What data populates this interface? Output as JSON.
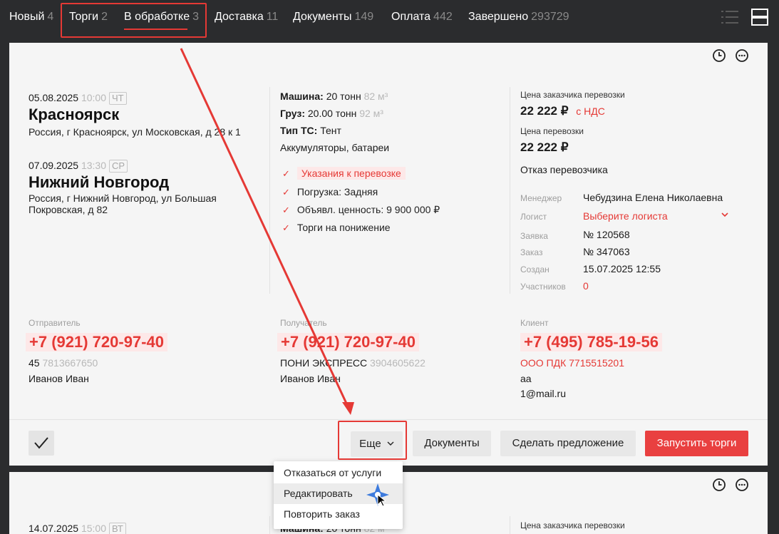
{
  "tabs": [
    {
      "label": "Новый",
      "count": "4"
    },
    {
      "label": "Торги",
      "count": "2"
    },
    {
      "label": "В обработке",
      "count": "3"
    },
    {
      "label": "Доставка",
      "count": "11"
    },
    {
      "label": "Документы",
      "count": "149"
    },
    {
      "label": "Оплата",
      "count": "442"
    },
    {
      "label": "Завершено",
      "count": "293729"
    }
  ],
  "order": {
    "load": {
      "date": "05.08.2025",
      "time": "10:00",
      "day": "ЧТ",
      "city": "Красноярск",
      "address": "Россия, г Красноярск, ул Московская, д 28 к 1"
    },
    "unload": {
      "date": "07.09.2025",
      "time": "13:30",
      "day": "СР",
      "city": "Нижний Новгород",
      "address": "Россия, г Нижний Новгород, ул Большая Покровская, д 82"
    },
    "vehicle": {
      "label": "Машина:",
      "value": "20 тонн",
      "volume": "82 м³"
    },
    "cargo": {
      "label": "Груз:",
      "value": "20.00 тонн",
      "volume": "92 м³"
    },
    "ts_type": {
      "label": "Тип ТС:",
      "value": "Тент"
    },
    "cargo_name": "Аккумуляторы, батареи",
    "checks": [
      "Указания к перевозке",
      "Погрузка: Задняя",
      "Объявл. ценность: 9 900 000 ₽",
      "Торги на понижение"
    ],
    "customer_price_label": "Цена заказчика перевозки",
    "customer_price": "22 222 ₽",
    "vat": "с НДС",
    "price_label": "Цена перевозки",
    "price": "22 222 ₽",
    "carrier_status": "Отказ перевозчика",
    "info": [
      {
        "label": "Менеджер",
        "value": "Чебудзина Елена Николаевна"
      },
      {
        "label": "Логист",
        "value": "Выберите логиста"
      },
      {
        "label": "Заявка",
        "value": "№ 120568"
      },
      {
        "label": "Заказ",
        "value": "№ 347063"
      },
      {
        "label": "Создан",
        "value": "15.07.2025 12:55"
      },
      {
        "label": "Участников",
        "value": "0"
      }
    ],
    "sender": {
      "label": "Отправитель",
      "phone": "+7 (921) 720-97-40",
      "org": "45",
      "inn": "7813667650",
      "person": "Иванов Иван"
    },
    "receiver": {
      "label": "Получатель",
      "phone": "+7 (921) 720-97-40",
      "org": "ПОНИ ЭКСПРЕСС",
      "inn": "3904605622",
      "person": "Иванов Иван"
    },
    "client": {
      "label": "Клиент",
      "phone": "+7 (495) 785-19-56",
      "org": "ООО ПДК 7715515201",
      "contact": "аа",
      "email": "1@mail.ru"
    }
  },
  "actions": {
    "more": "Еще",
    "documents": "Документы",
    "offer": "Сделать предложение",
    "start": "Запустить торги"
  },
  "dropdown": [
    "Отказаться от услуги",
    "Редактировать",
    "Повторить заказ"
  ],
  "order2": {
    "date": "14.07.2025",
    "time": "15:00",
    "day": "ВТ",
    "vehicle_label": "Машина:",
    "vehicle_value": "20 тонн",
    "vehicle_volume": "82 м³",
    "customer_price_label": "Цена заказчика перевозки"
  },
  "colors": {
    "accent": "#e53935",
    "background": "#2b2c2e",
    "card": "#f5f5f5"
  }
}
